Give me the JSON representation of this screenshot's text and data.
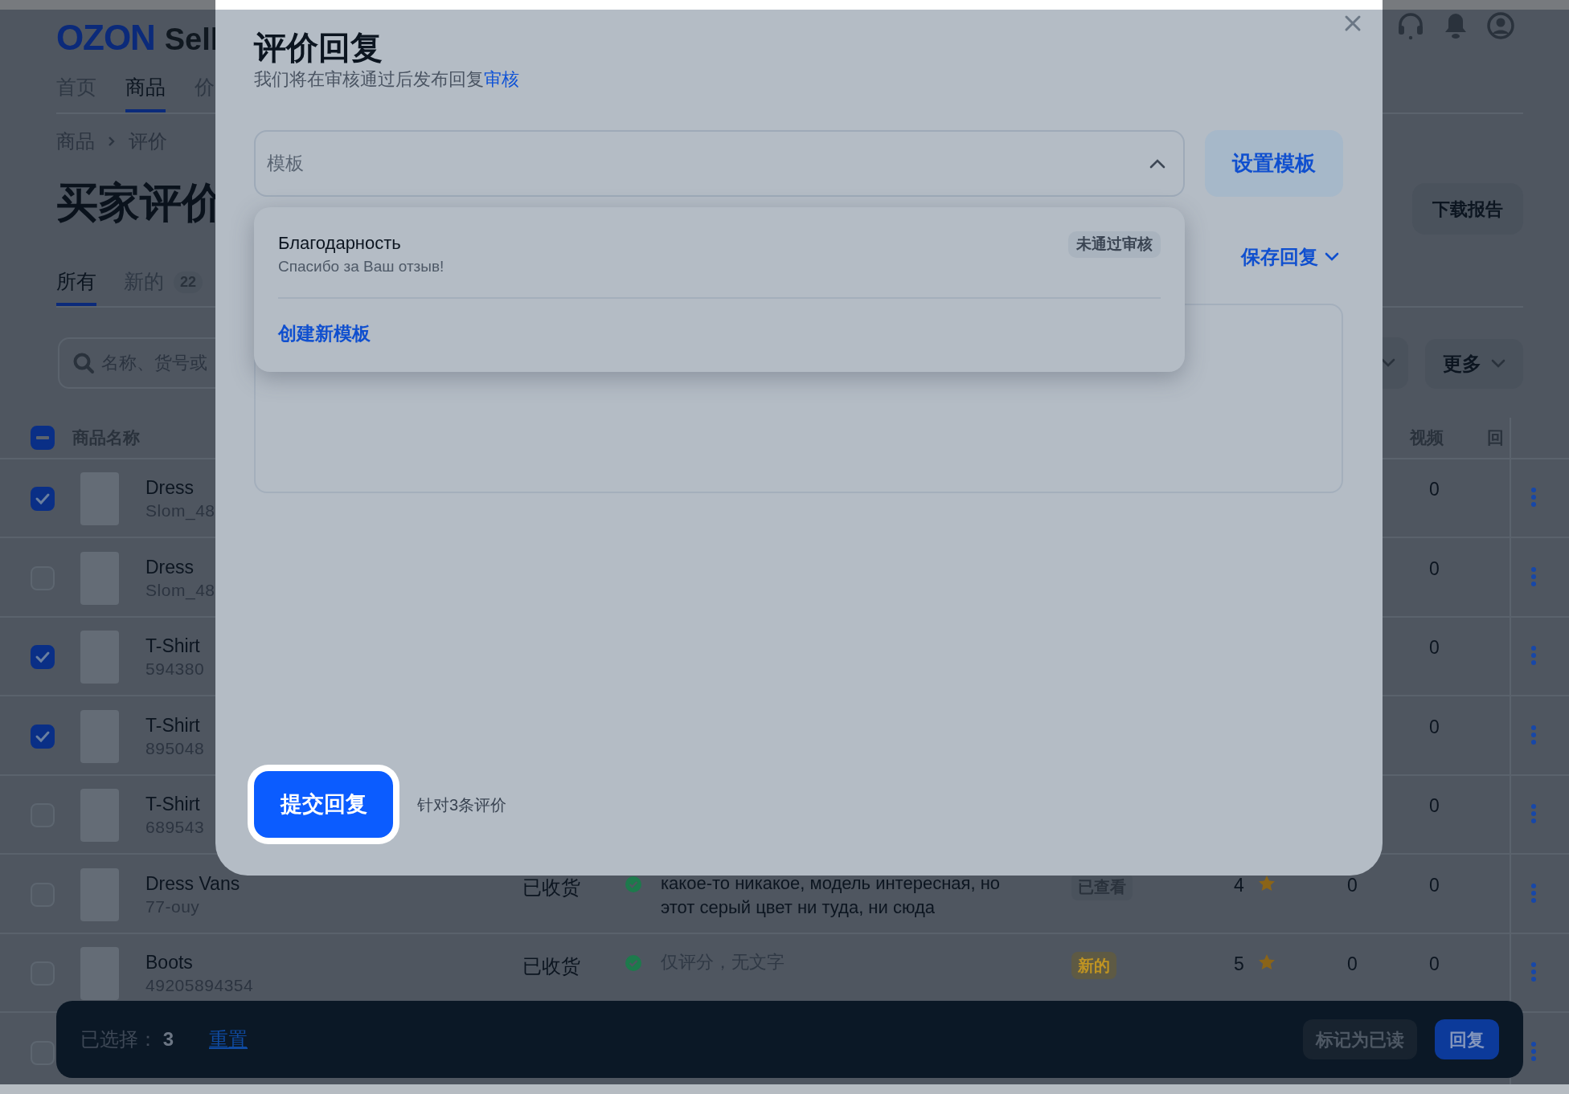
{
  "header": {
    "logo": "OZON",
    "logo_suffix": "Sell"
  },
  "nav": [
    {
      "label": "首页",
      "selected": false
    },
    {
      "label": "商品",
      "selected": true
    },
    {
      "label": "价",
      "selected": false
    }
  ],
  "breadcrumb": [
    "商品",
    "评价"
  ],
  "page_title": "买家评价",
  "download_button": "下载报告",
  "tabs": [
    {
      "label": "所有",
      "selected": true
    },
    {
      "label": "新的",
      "count": "22",
      "selected": false
    }
  ],
  "search": {
    "placeholder": "名称、货号或"
  },
  "more_button": "更多",
  "table": {
    "header_checkbox": {
      "checked": true,
      "partial": true
    },
    "columns": [
      "商品名称",
      "视频",
      "回"
    ],
    "rows": [
      {
        "checked": true,
        "name": "Dress",
        "sku": "Slom_48",
        "video": "0"
      },
      {
        "checked": false,
        "name": "Dress",
        "sku": "Slom_48",
        "video": "0"
      },
      {
        "checked": true,
        "name": "T-Shirt",
        "sku": "594380",
        "video": "0"
      },
      {
        "checked": true,
        "name": "T-Shirt",
        "sku": "895048",
        "video": "0"
      },
      {
        "checked": false,
        "name": "T-Shirt",
        "sku": "689543",
        "video": "0"
      },
      {
        "checked": false,
        "name": "Dress Vans",
        "sku": "77-ouy",
        "status": "已收货",
        "verified": true,
        "review": {
          "text": "какое-то никакое, модель интересная, но этот серый цвет ни туда, ни сюда",
          "kind": "text"
        },
        "badge": {
          "text": "已查看",
          "kind": "viewed"
        },
        "rating": "4",
        "replies": "0",
        "video": "0"
      },
      {
        "checked": false,
        "name": "Boots",
        "sku": "49205894354",
        "status": "已收货",
        "verified": true,
        "review": {
          "text": "仅评分，无文字",
          "kind": "rating_only"
        },
        "badge": {
          "text": "新的",
          "kind": "new"
        },
        "rating": "5",
        "replies": "0",
        "video": "0"
      },
      {
        "checked": false
      }
    ]
  },
  "bottom_bar": {
    "selected_label": "已选择：",
    "selected_count": "3",
    "reset_link": "重置",
    "mark_read_button": "标记为已读",
    "reply_button": "回复"
  },
  "modal": {
    "title": "评价回复",
    "subtitle": "我们将在审核通过后发布回复",
    "subtitle_link": "审核",
    "template_select": {
      "placeholder": "模板",
      "expanded": true
    },
    "setup_button": "设置模板",
    "dropdown": {
      "items": [
        {
          "title": "Благодарность",
          "text": "Спасибо за Ваш отзыв!",
          "badge": "未通过审核"
        }
      ],
      "create_link": "创建新模板"
    },
    "save_reply": "保存回复",
    "submit_button": "提交回复",
    "submit_note": "针对3条评价"
  }
}
